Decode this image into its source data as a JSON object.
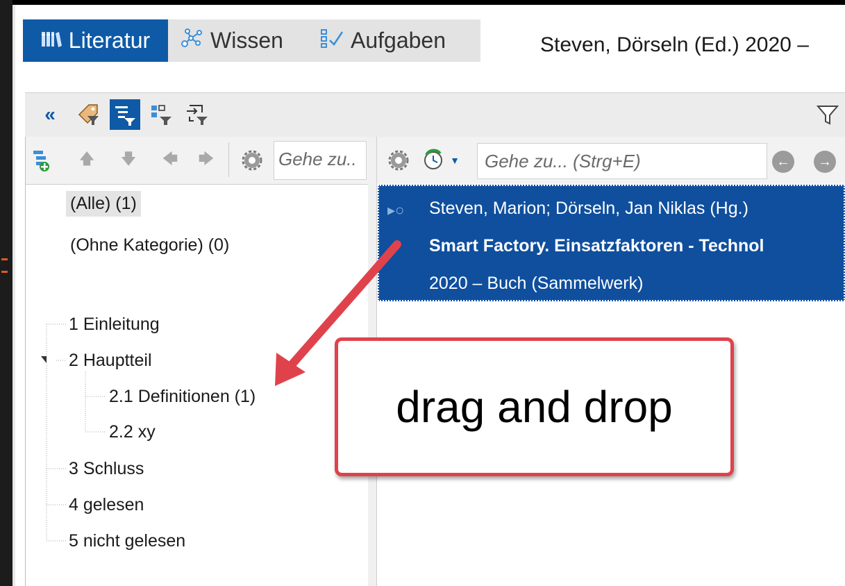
{
  "tabs": [
    {
      "label": "Literatur",
      "icon": "library-icon",
      "active": true
    },
    {
      "label": "Wissen",
      "icon": "knowledge-icon",
      "active": false
    },
    {
      "label": "Aufgaben",
      "icon": "tasks-icon",
      "active": false
    }
  ],
  "document_title": "Steven, Dörseln (Ed.) 2020 –",
  "left_panel": {
    "search_placeholder": "Gehe zu..",
    "categories": [
      "(Alle) (1)",
      "(Ohne Kategorie) (0)"
    ],
    "tree": [
      {
        "label": "1 Einleitung"
      },
      {
        "label": "2 Hauptteil",
        "expanded": true
      },
      {
        "label": "2.1 Definitionen (1)"
      },
      {
        "label": "2.2 xy"
      },
      {
        "label": "3 Schluss"
      },
      {
        "label": "4 gelesen"
      },
      {
        "label": "5 nicht gelesen"
      }
    ]
  },
  "right_panel": {
    "search_placeholder": "Gehe zu... (Strg+E)",
    "record": {
      "authors": "Steven, Marion; Dörseln, Jan Niklas (Hg.)",
      "title": "Smart Factory. Einsatzfaktoren - Technol",
      "meta": "2020 – Buch (Sammelwerk)"
    }
  },
  "callout": {
    "text": "drag and drop"
  },
  "colors": {
    "accent": "#0f5aa6",
    "selection": "#0f4f9e",
    "callout_border": "#e0424c",
    "arrow": "#e0424c"
  }
}
